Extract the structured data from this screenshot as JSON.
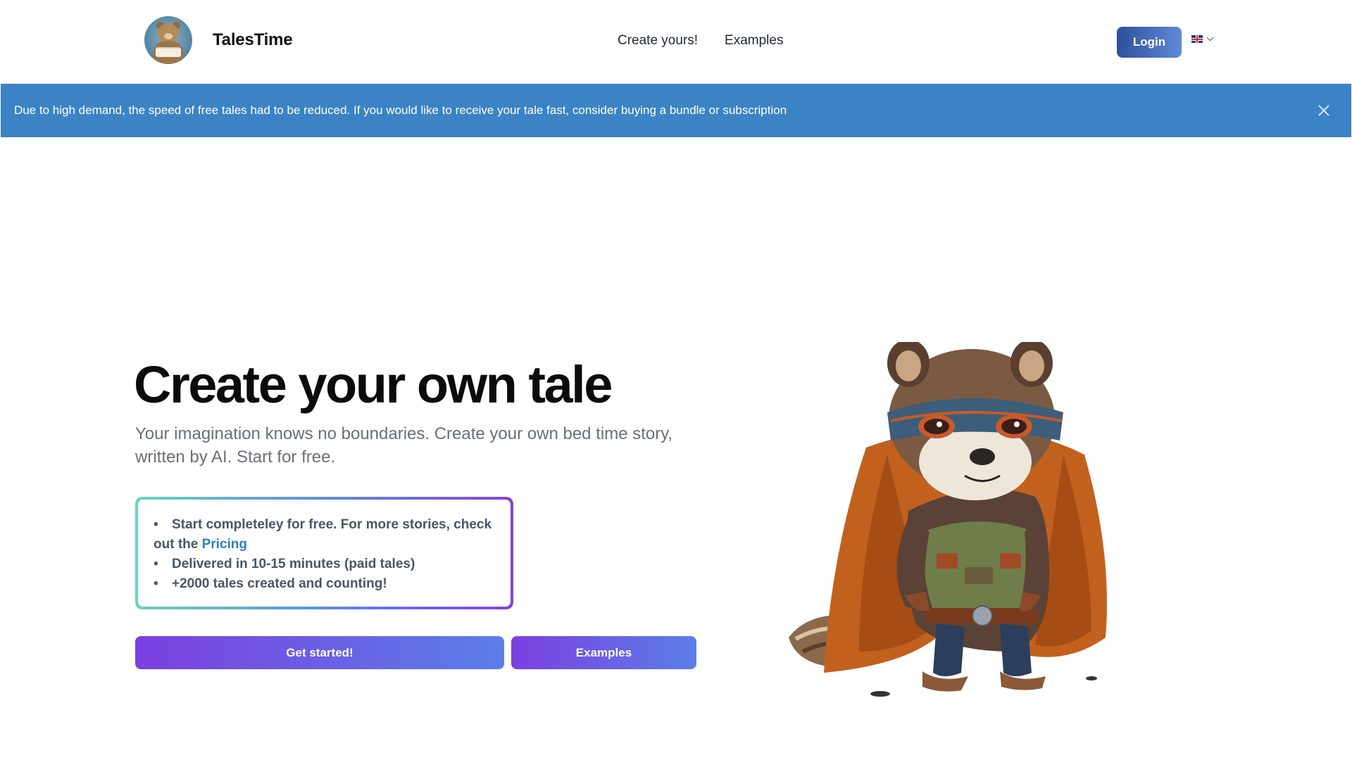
{
  "header": {
    "brand_name": "TalesTime",
    "nav": [
      {
        "label": "Create yours!"
      },
      {
        "label": "Examples"
      }
    ],
    "login_label": "Login",
    "language": "English",
    "language_icon": "uk-flag-icon"
  },
  "alert": {
    "message": "Due to high demand, the speed of free tales had to be reduced. If you would like to receive your tale fast, consider buying a bundle or subscription",
    "close_icon": "close-icon",
    "background": "#3b83c4"
  },
  "hero": {
    "title": "Create your own tale",
    "subtitle": "Your imagination knows no boundaries. Create your own bed time story, written by AI. Start for free.",
    "features": {
      "item1_text": "Start completeley for free. For more stories, check out the ",
      "item1_link": "Pricing",
      "item2": "Delivered in 10-15 minutes (paid tales)",
      "item3": "+2000 tales created and counting!"
    },
    "cta_primary": "Get started!",
    "cta_secondary": "Examples",
    "illustration": "raccoon-superhero-illustration"
  },
  "colors": {
    "accent_purple": "#7b3fe0",
    "accent_blue": "#5b7ee8",
    "login_blue": "#2f4f9a",
    "link_blue": "#2f7fc2"
  }
}
